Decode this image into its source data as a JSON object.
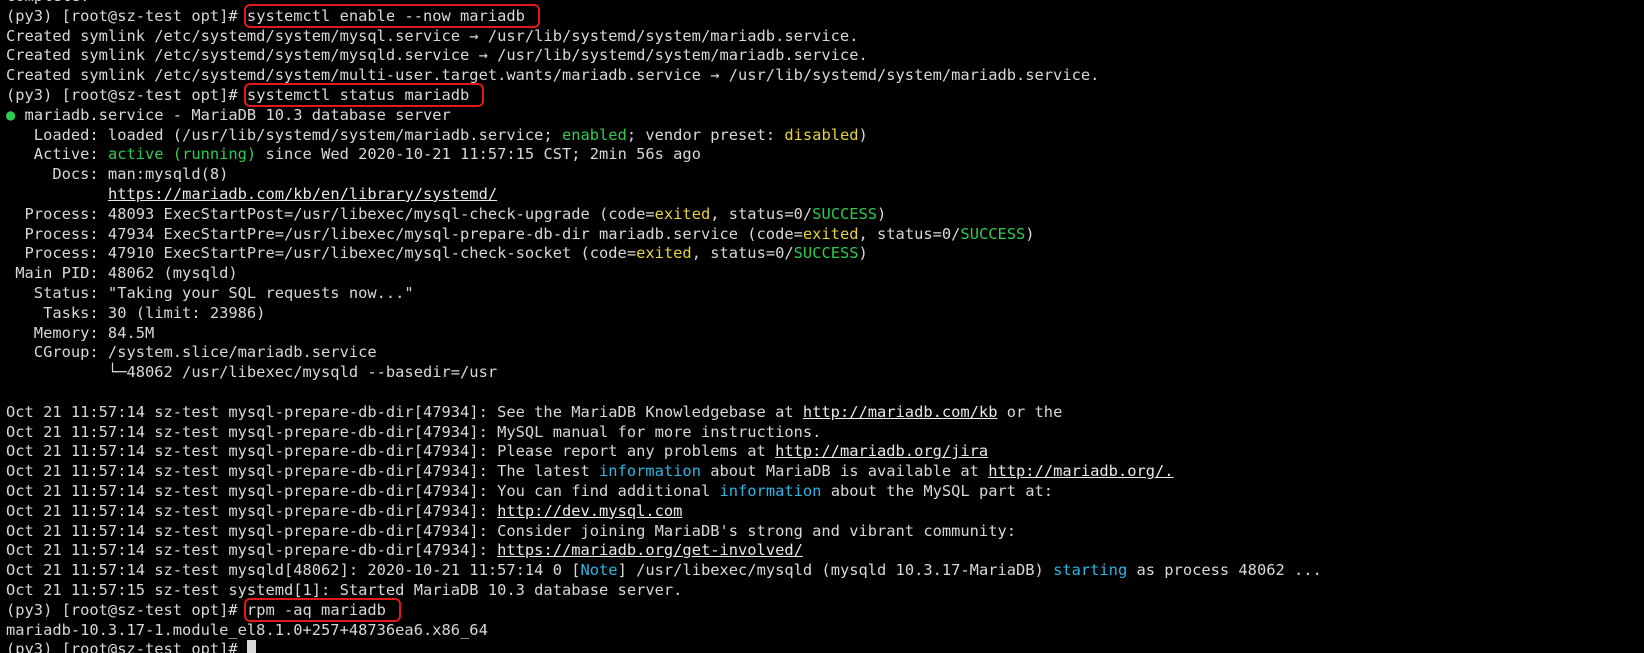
{
  "terminal": {
    "lines": [
      {
        "segments": [
          {
            "t": "complete."
          }
        ]
      },
      {
        "segments": [
          {
            "t": "(py3) [root@sz-test opt]# "
          },
          {
            "t": "systemctl enable --now mariadb",
            "c": "cmd"
          }
        ]
      },
      {
        "segments": [
          {
            "t": "Created symlink /etc/systemd/system/mysql.service → /usr/lib/systemd/system/mariadb.service."
          }
        ]
      },
      {
        "segments": [
          {
            "t": "Created symlink /etc/systemd/system/mysqld.service → /usr/lib/systemd/system/mariadb.service."
          }
        ]
      },
      {
        "segments": [
          {
            "t": "Created symlink /etc/systemd/system/multi-user.target.wants/mariadb.service → /usr/lib/systemd/system/mariadb.service."
          }
        ]
      },
      {
        "segments": [
          {
            "t": "(py3) [root@sz-test opt]# "
          },
          {
            "t": "systemctl status mariadb",
            "c": "cmd"
          }
        ]
      },
      {
        "segments": [
          {
            "t": "●",
            "c": "dot"
          },
          {
            "t": " mariadb.service - MariaDB 10.3 database server"
          }
        ]
      },
      {
        "segments": [
          {
            "t": "   Loaded: loaded (/usr/lib/systemd/system/mariadb.service; "
          },
          {
            "t": "enabled",
            "c": "green"
          },
          {
            "t": "; vendor preset: "
          },
          {
            "t": "disabled",
            "c": "yellow"
          },
          {
            "t": ")"
          }
        ]
      },
      {
        "segments": [
          {
            "t": "   Active: "
          },
          {
            "t": "active (running)",
            "c": "green"
          },
          {
            "t": " since Wed 2020-10-21 11:57:15 CST; 2min 56s ago"
          }
        ]
      },
      {
        "segments": [
          {
            "t": "     Docs: man:mysqld(8)"
          }
        ]
      },
      {
        "segments": [
          {
            "t": "           "
          },
          {
            "t": "https://mariadb.com/kb/en/library/systemd/",
            "c": "link"
          }
        ]
      },
      {
        "segments": [
          {
            "t": "  Process: 48093 ExecStartPost=/usr/libexec/mysql-check-upgrade (code="
          },
          {
            "t": "exited",
            "c": "yellow"
          },
          {
            "t": ", status=0/"
          },
          {
            "t": "SUCCESS",
            "c": "green"
          },
          {
            "t": ")"
          }
        ]
      },
      {
        "segments": [
          {
            "t": "  Process: 47934 ExecStartPre=/usr/libexec/mysql-prepare-db-dir mariadb.service (code="
          },
          {
            "t": "exited",
            "c": "yellow"
          },
          {
            "t": ", status=0/"
          },
          {
            "t": "SUCCESS",
            "c": "green"
          },
          {
            "t": ")"
          }
        ]
      },
      {
        "segments": [
          {
            "t": "  Process: 47910 ExecStartPre=/usr/libexec/mysql-check-socket (code="
          },
          {
            "t": "exited",
            "c": "yellow"
          },
          {
            "t": ", status=0/"
          },
          {
            "t": "SUCCESS",
            "c": "green"
          },
          {
            "t": ")"
          }
        ]
      },
      {
        "segments": [
          {
            "t": " Main PID: 48062 (mysqld)"
          }
        ]
      },
      {
        "segments": [
          {
            "t": "   Status: \"Taking your SQL requests now...\""
          }
        ]
      },
      {
        "segments": [
          {
            "t": "    Tasks: 30 (limit: 23986)"
          }
        ]
      },
      {
        "segments": [
          {
            "t": "   Memory: 84.5M"
          }
        ]
      },
      {
        "segments": [
          {
            "t": "   CGroup: /system.slice/mariadb.service"
          }
        ]
      },
      {
        "segments": [
          {
            "t": "           └─48062 /usr/libexec/mysqld --basedir=/usr"
          }
        ]
      },
      {
        "segments": [
          {
            "t": ""
          }
        ]
      },
      {
        "segments": [
          {
            "t": "Oct 21 11:57:14 sz-test mysql-prepare-db-dir[47934]: See the MariaDB Knowledgebase at "
          },
          {
            "t": "http://mariadb.com/kb",
            "c": "link"
          },
          {
            "t": " or the"
          }
        ]
      },
      {
        "segments": [
          {
            "t": "Oct 21 11:57:14 sz-test mysql-prepare-db-dir[47934]: MySQL manual for more instructions."
          }
        ]
      },
      {
        "segments": [
          {
            "t": "Oct 21 11:57:14 sz-test mysql-prepare-db-dir[47934]: Please report any problems at "
          },
          {
            "t": "http://mariadb.org/jira",
            "c": "link"
          }
        ]
      },
      {
        "segments": [
          {
            "t": "Oct 21 11:57:14 sz-test mysql-prepare-db-dir[47934]: The latest "
          },
          {
            "t": "information",
            "c": "cyan"
          },
          {
            "t": " about MariaDB is available at "
          },
          {
            "t": "http://mariadb.org/.",
            "c": "link"
          }
        ]
      },
      {
        "segments": [
          {
            "t": "Oct 21 11:57:14 sz-test mysql-prepare-db-dir[47934]: You can find additional "
          },
          {
            "t": "information",
            "c": "cyan"
          },
          {
            "t": " about the MySQL part at:"
          }
        ]
      },
      {
        "segments": [
          {
            "t": "Oct 21 11:57:14 sz-test mysql-prepare-db-dir[47934]: "
          },
          {
            "t": "http://dev.mysql.com",
            "c": "link"
          }
        ]
      },
      {
        "segments": [
          {
            "t": "Oct 21 11:57:14 sz-test mysql-prepare-db-dir[47934]: Consider joining MariaDB's strong and vibrant community:"
          }
        ]
      },
      {
        "segments": [
          {
            "t": "Oct 21 11:57:14 sz-test mysql-prepare-db-dir[47934]: "
          },
          {
            "t": "https://mariadb.org/get-involved/",
            "c": "link"
          }
        ]
      },
      {
        "segments": [
          {
            "t": "Oct 21 11:57:14 sz-test mysqld[48062]: 2020-10-21 11:57:14 0 ["
          },
          {
            "t": "Note",
            "c": "cyan"
          },
          {
            "t": "] /usr/libexec/mysqld (mysqld 10.3.17-MariaDB) "
          },
          {
            "t": "starting",
            "c": "cyan"
          },
          {
            "t": " as process 48062 ..."
          }
        ]
      },
      {
        "segments": [
          {
            "t": "Oct 21 11:57:15 sz-test systemd[1]: Started MariaDB 10.3 database server."
          }
        ]
      },
      {
        "segments": [
          {
            "t": "(py3) [root@sz-test opt]# "
          },
          {
            "t": "rpm -aq mariadb",
            "c": "cmd"
          }
        ]
      },
      {
        "segments": [
          {
            "t": "mariadb-10.3.17-1.module_el8.1.0+257+48736ea6.x86_64"
          }
        ]
      },
      {
        "segments": [
          {
            "t": "(py3) [root@sz-test opt]# "
          },
          {
            "t": "",
            "c": "cursor"
          }
        ]
      }
    ]
  },
  "colors": {
    "background": "#000000",
    "text": "#d8d8d8",
    "green": "#2ecc52",
    "yellow": "#e7d43a",
    "cyan": "#2ab6e6",
    "highlight_box": "#e01a1a"
  }
}
